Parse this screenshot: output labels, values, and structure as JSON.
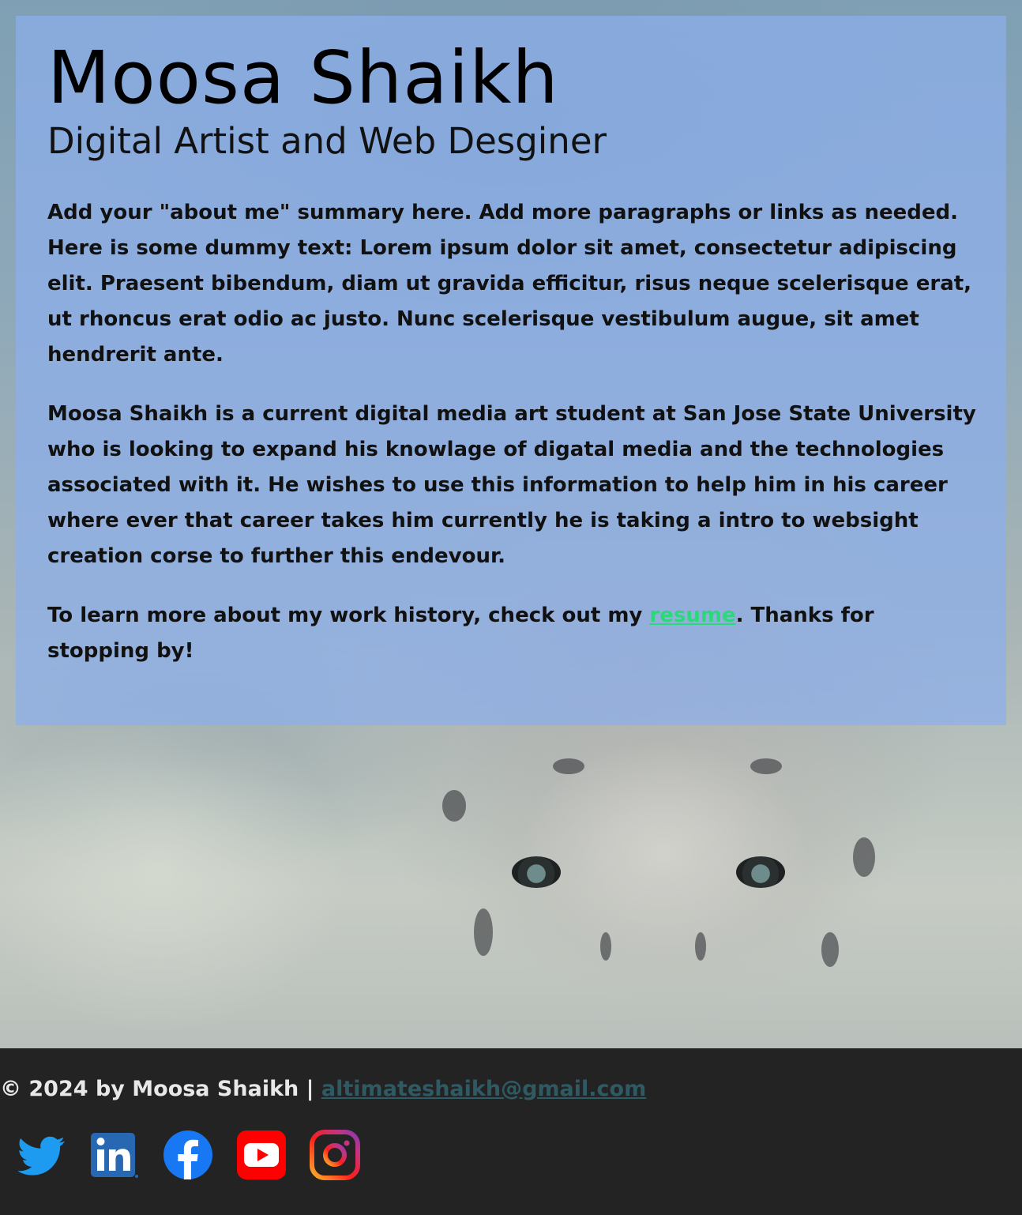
{
  "header": {
    "name": "Moosa Shaikh",
    "subtitle": "Digital Artist and Web Desginer"
  },
  "about": {
    "paragraph_1": "Add your \"about me\" summary here. Add more paragraphs or links as needed. Here is some dummy text: Lorem ipsum dolor sit amet, consectetur adipiscing elit. Praesent bibendum, diam ut gravida efficitur, risus neque scelerisque erat, ut rhoncus erat odio ac justo. Nunc scelerisque vestibulum augue, sit amet hendrerit ante.",
    "paragraph_2": "Moosa Shaikh is a current digital media art student at San Jose State University who is looking to expand his knowlage of digatal media and the technologies associated with it. He wishes to use this information to help him in his career where ever that career takes him currently he is taking a intro to websight creation corse to further this endevour.",
    "paragraph_3_before": "To learn more about my work history, check out my ",
    "resume_link": "resume",
    "paragraph_3_after": ". Thanks for stopping by!"
  },
  "footer": {
    "copyright": "© 2024 by Moosa Shaikh | ",
    "email": "altimateshaikh@gmail.com",
    "social": [
      {
        "icon": "twitter-icon",
        "color": "#1d9bf0"
      },
      {
        "icon": "linkedin-icon",
        "color": "#2867b2"
      },
      {
        "icon": "facebook-icon",
        "color": "#1877f2"
      },
      {
        "icon": "youtube-icon",
        "color": "#ff0000"
      },
      {
        "icon": "instagram-icon",
        "color": "#d6249f"
      }
    ]
  },
  "colors": {
    "card_overlay": "#8cafeb",
    "link": "#2bd97b",
    "footer_bg": "#232323",
    "email_link": "#2f5a63"
  }
}
